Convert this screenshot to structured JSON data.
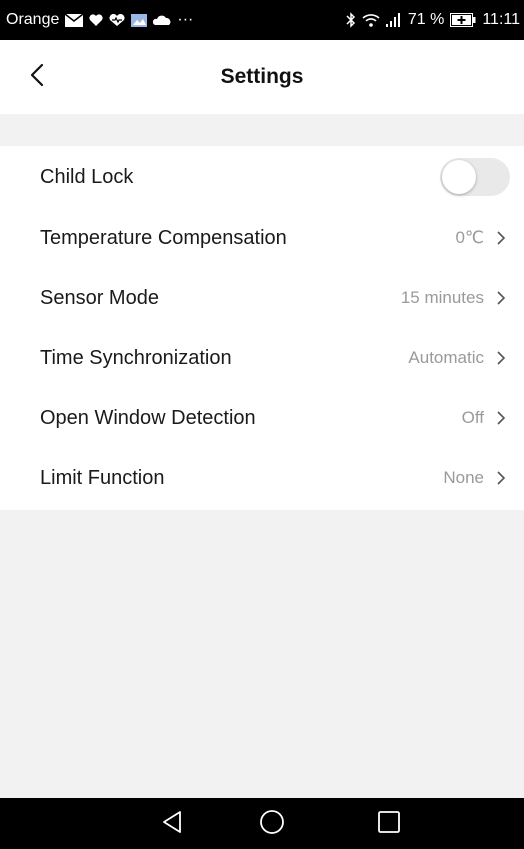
{
  "status_bar": {
    "carrier": "Orange",
    "notification_icons": [
      "mail-icon",
      "heart-icon",
      "heart-icon",
      "image-icon",
      "cloud-icon"
    ],
    "more": "···",
    "battery_percent": "71 %",
    "time": "11:11"
  },
  "header": {
    "title": "Settings"
  },
  "settings": [
    {
      "label": "Child Lock",
      "value": "",
      "toggle": false
    },
    {
      "label": "Temperature Compensation",
      "value": "0℃"
    },
    {
      "label": "Sensor Mode",
      "value": "15 minutes"
    },
    {
      "label": "Time Synchronization",
      "value": "Automatic"
    },
    {
      "label": "Open Window Detection",
      "value": "Off"
    },
    {
      "label": "Limit Function",
      "value": "None"
    }
  ],
  "colors": {
    "background": "#f2f2f2",
    "card": "#ffffff",
    "value_text": "#9a9a9a",
    "toggle_off": "#e9e9e9"
  }
}
